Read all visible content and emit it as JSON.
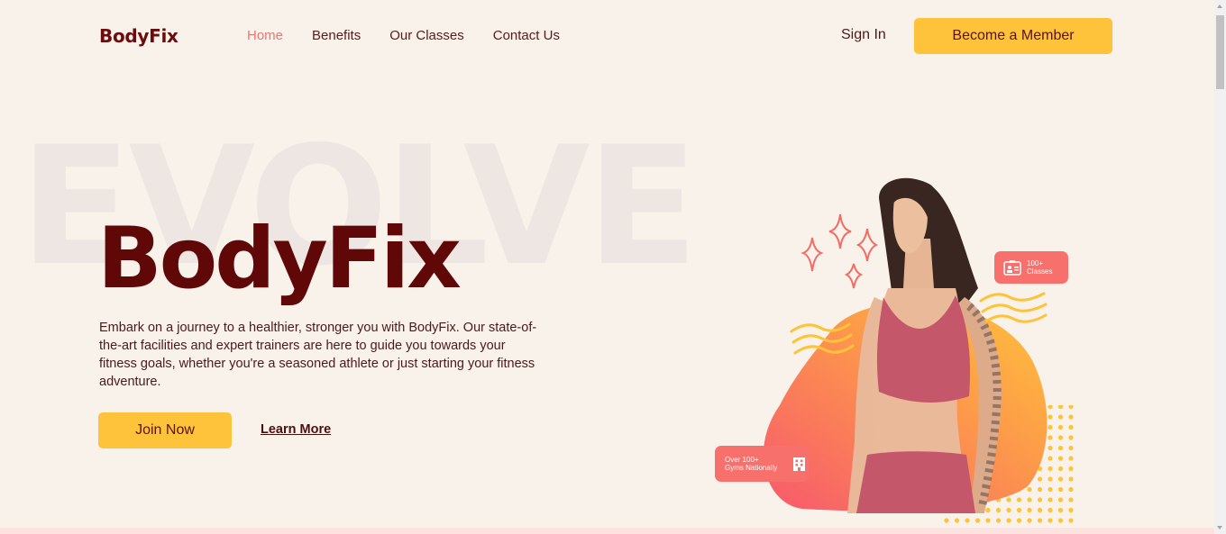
{
  "nav": {
    "logo": "BodyFix",
    "links": [
      "Home",
      "Benefits",
      "Our Classes",
      "Contact Us"
    ],
    "active": "Home",
    "signin": "Sign In",
    "cta": "Become a Member"
  },
  "hero": {
    "background_word": "EVOLVE",
    "title": "BodyFix",
    "description": "Embark on a journey to a healthier, stronger you with BodyFix. Our state-of-the-art facilities and expert trainers are here to guide you towards your fitness goals, whether you're a seasoned athlete or just starting your fitness adventure.",
    "primary_button": "Join Now",
    "secondary_link": "Learn More"
  },
  "badges": {
    "classes": {
      "line1": "100+",
      "line2": "Classes",
      "icon": "id-card-icon"
    },
    "gyms": {
      "line1": "Over 100+",
      "line2": "Gyms Nationally",
      "icon": "building-icon"
    }
  },
  "colors": {
    "background": "#f8f2ea",
    "accent_yellow": "#fec33a",
    "brand_maroon": "#600808",
    "coral": "#f7706c",
    "active_link": "#e8786f"
  }
}
